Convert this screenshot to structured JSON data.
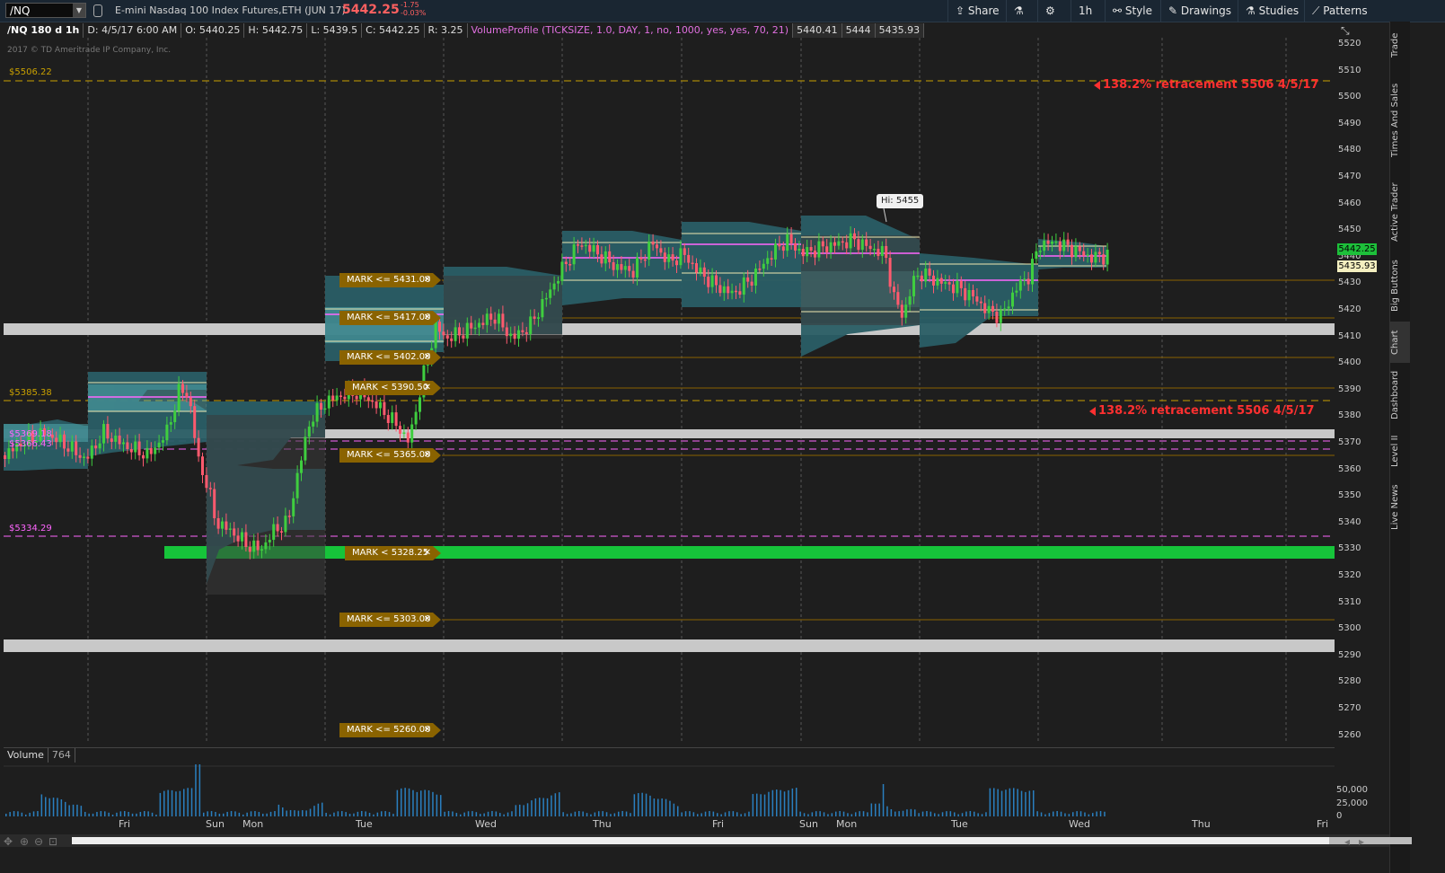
{
  "header": {
    "symbol": "/NQ",
    "description": "E-mini Nasdaq 100 Index Futures,ETH (JUN 17)",
    "last_price": "5442.25",
    "change": "-1.75",
    "change_pct": "-0.03%",
    "buttons": [
      "Share",
      "1h",
      "Style",
      "Drawings",
      "Studies",
      "Patterns"
    ]
  },
  "info_bar": {
    "symbol_period": "/NQ 180 d 1h",
    "date": "D: 4/5/17 6:00 AM",
    "open": "O: 5440.25",
    "high": "H: 5442.75",
    "low": "L: 5439.5",
    "close": "C: 5442.25",
    "range": "R: 3.25",
    "study": "VolumeProfile (TICKSIZE, 1.0, DAY, 1, no, 1000, yes, yes, 70, 21)",
    "v1": "5440.41",
    "v2": "5444",
    "v3": "5435.93"
  },
  "copyright": "2017 © TD Ameritrade IP Company, Inc.",
  "price_ticks": [
    "5520",
    "5510",
    "5500",
    "5490",
    "5480",
    "5470",
    "5460",
    "5450",
    "5440",
    "5430",
    "5420",
    "5410",
    "5400",
    "5390",
    "5380",
    "5370",
    "5360",
    "5350",
    "5340",
    "5330",
    "5320",
    "5310",
    "5300",
    "5290",
    "5280",
    "5270",
    "5260"
  ],
  "price_tags": {
    "last": "5442.25",
    "poc": "5435.93"
  },
  "level_labels": [
    "$5506.22",
    "$5385.38",
    "$5369.18",
    "$5366.43",
    "$5334.29"
  ],
  "alerts": [
    "MARK <= 5431.00",
    "MARK <= 5417.00",
    "MARK <= 5402.00",
    "MARK < 5390.50",
    "MARK <= 5365.00",
    "MARK < 5328.25",
    "MARK <= 5303.00",
    "MARK <= 5260.00"
  ],
  "annotations": [
    "138.2% retracement 5506 4/5/17",
    "138.2% retracement 5506 4/5/17"
  ],
  "hi_label": "Hi: 5455",
  "volume": {
    "title": "Volume",
    "value": "764",
    "ticks": [
      "50,000",
      "25,000",
      "0"
    ]
  },
  "time_labels": [
    "Fri",
    "Sun",
    "Mon",
    "Tue",
    "Wed",
    "Thu",
    "Fri",
    "Sun",
    "Mon",
    "Tue",
    "Wed",
    "Thu",
    "Fri"
  ],
  "right_tabs": [
    "Trade",
    "Times And Sales",
    "Active Trader",
    "Big Buttons",
    "Chart",
    "Dashboard",
    "Level II",
    "Live News"
  ],
  "colors": {
    "up": "#3fce3f",
    "down": "#ff5a6e",
    "profile": "#2a5e66",
    "alert": "#8a6300",
    "green_zone": "#16c43a",
    "gray_zone": "#c8c8c8"
  }
}
